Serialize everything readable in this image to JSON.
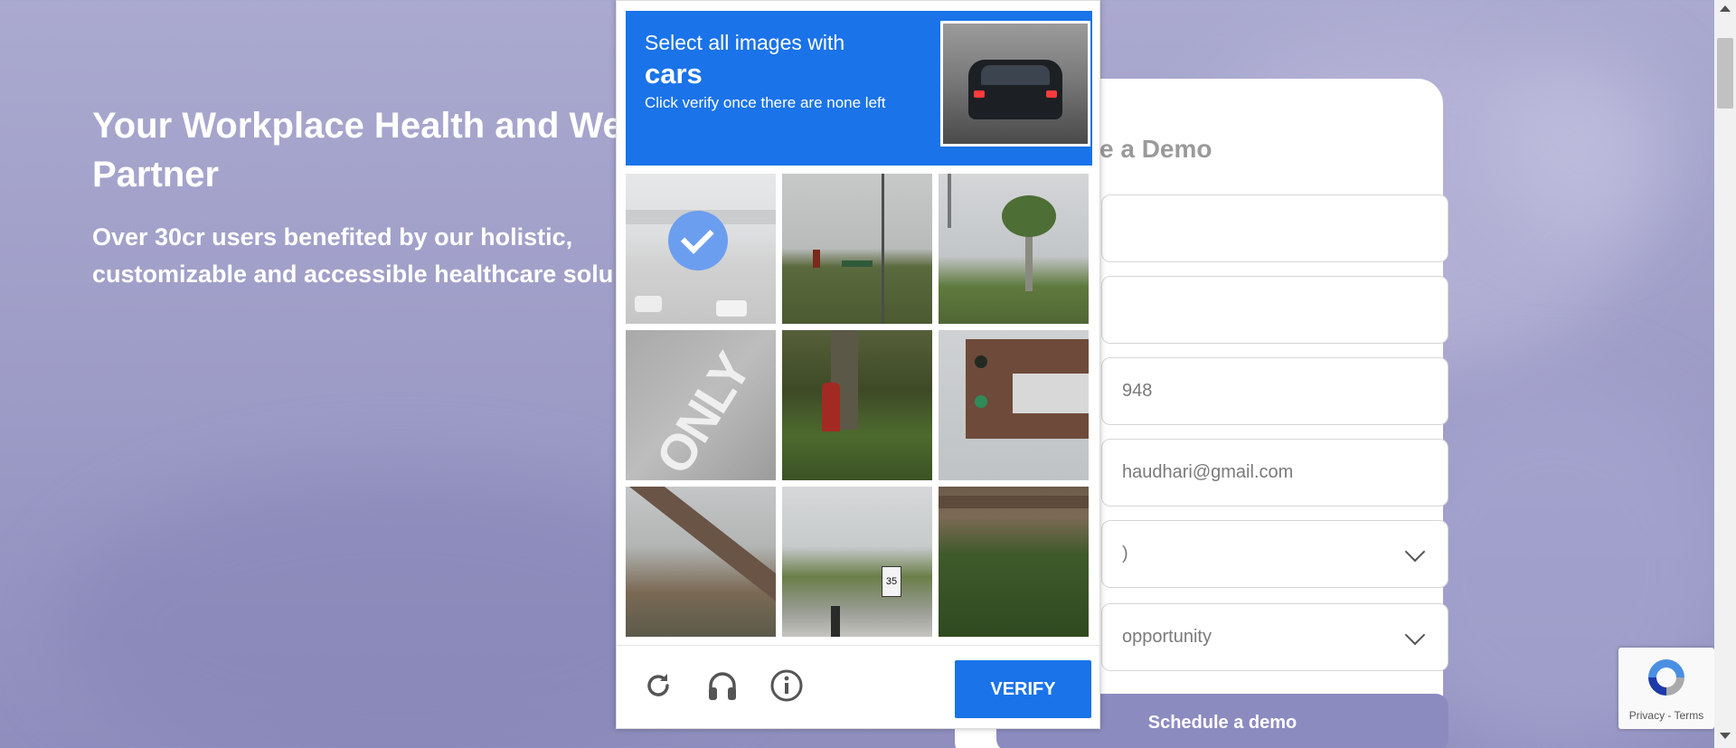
{
  "hero": {
    "title": "Your Workplace Health and We Partner",
    "subtitle": "Over 30cr users benefited by our holistic, customizable and accessible healthcare solu"
  },
  "demo_form": {
    "title": "e a Demo",
    "fields": [
      {
        "value": ""
      },
      {
        "value": ""
      },
      {
        "value": "948"
      },
      {
        "value": "haudhari@gmail.com"
      },
      {
        "value": ")"
      },
      {
        "value": "opportunity"
      }
    ],
    "submit_label": "Schedule a demo"
  },
  "captcha": {
    "instruction_line1": "Select all images with",
    "keyword": "cars",
    "instruction_line2": "Click verify once there are none left",
    "tiles": [
      {
        "selected": true
      },
      {
        "selected": false
      },
      {
        "selected": false
      },
      {
        "selected": false
      },
      {
        "selected": false
      },
      {
        "selected": false
      },
      {
        "selected": false
      },
      {
        "selected": false
      },
      {
        "selected": false
      }
    ],
    "tile_details": {
      "road_text": "ONLY",
      "speed_sign": "35"
    },
    "verify_label": "VERIFY",
    "icons": [
      "reload-icon",
      "audio-challenge-icon",
      "info-icon"
    ]
  },
  "recaptcha_badge": {
    "text": "Privacy - Terms"
  },
  "colors": {
    "accent": "#1a73e8",
    "hero_bg": "#9c9bc6",
    "demo_button": "#8c8bc0"
  }
}
